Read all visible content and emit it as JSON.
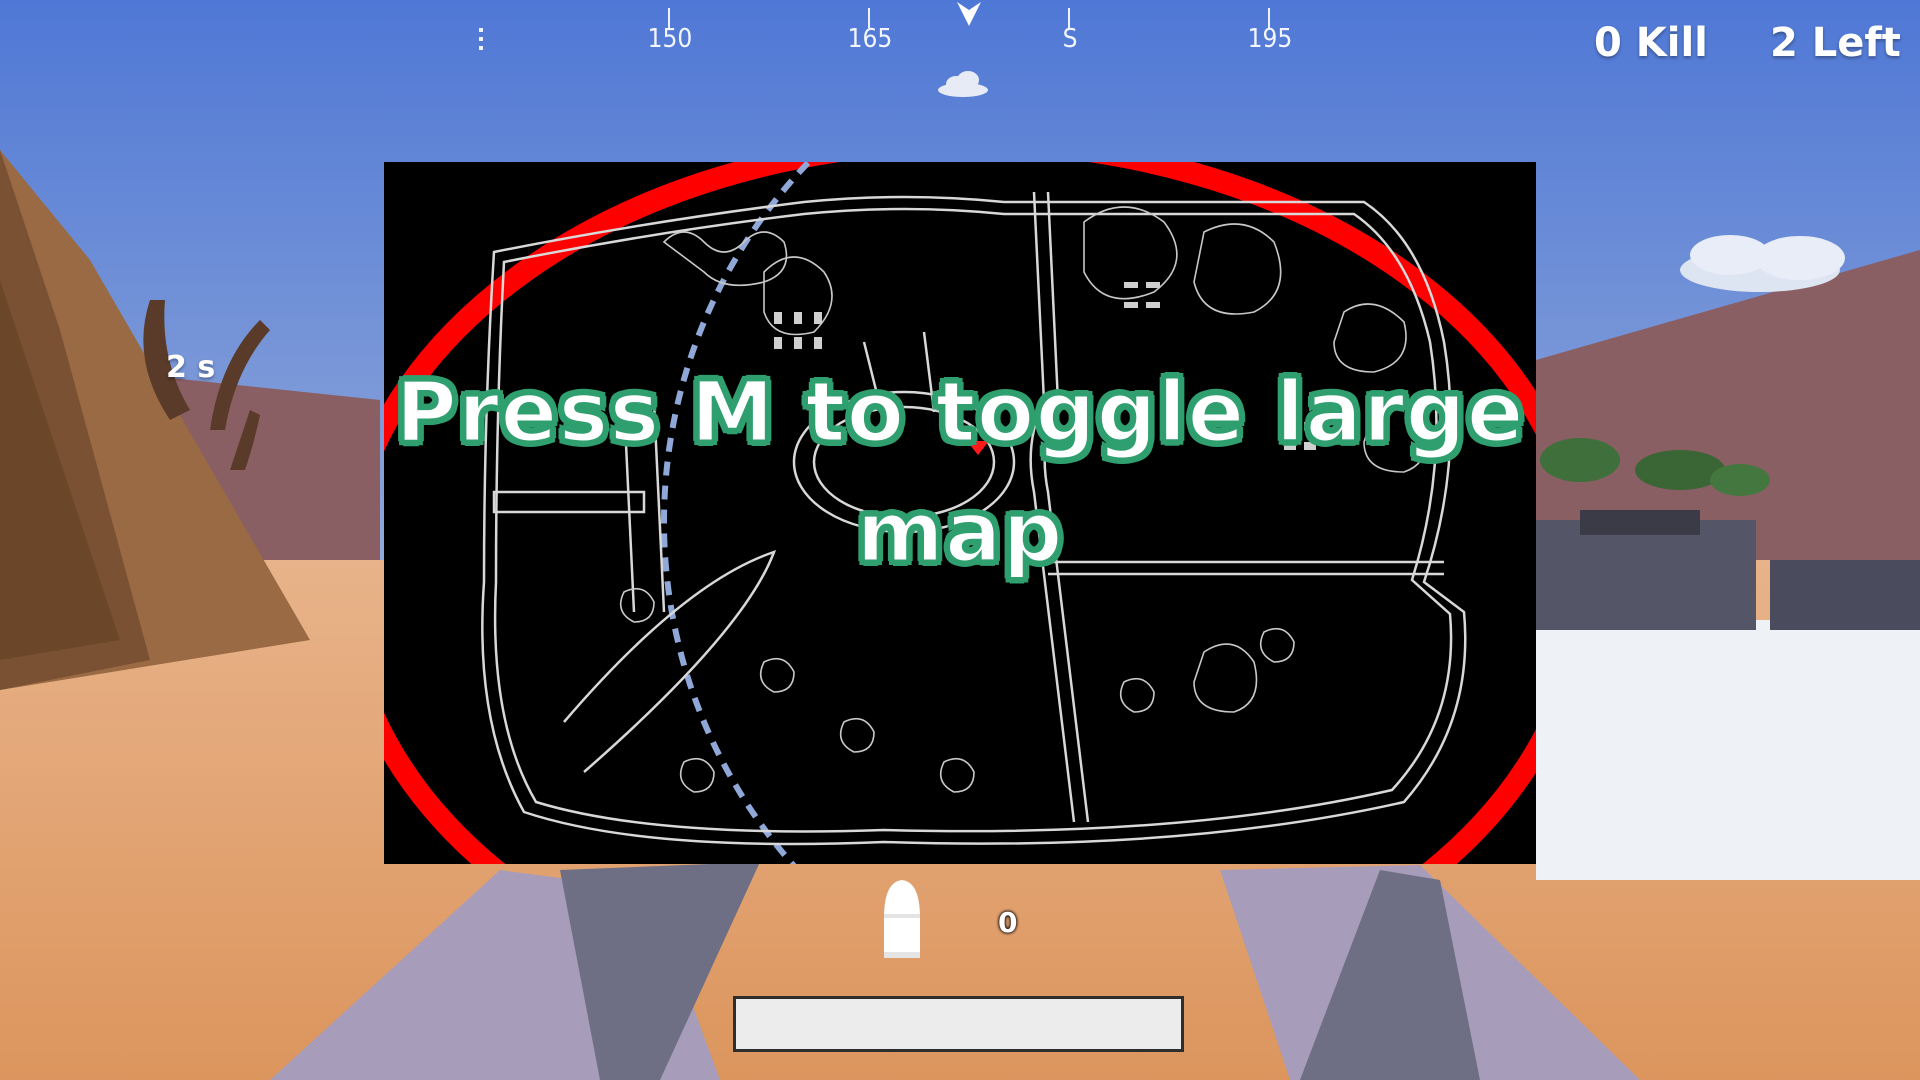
{
  "hud": {
    "compass": {
      "labels": [
        "150",
        "165",
        "S",
        "195"
      ],
      "menu_icon": "vertical-ellipsis-icon",
      "pointer_icon": "heading-pointer-icon",
      "weather_icon": "cloud-icon"
    },
    "kills": "0 Kill",
    "players_left": "2 Left",
    "timer": "2 s",
    "ammo_count": "0",
    "ammo_icon": "bullet-icon"
  },
  "minimap": {
    "hint": "Press M to toggle large map",
    "player_marker_icon": "player-arrow-icon",
    "zone_color": "#ff0000",
    "safe_zone_color": "#8fa8d8"
  },
  "colors": {
    "sky_top": "#4f78d6",
    "sky_bottom": "#9fb3dc",
    "sand": "#de9a64",
    "hint_outline": "#2f9f6f"
  }
}
